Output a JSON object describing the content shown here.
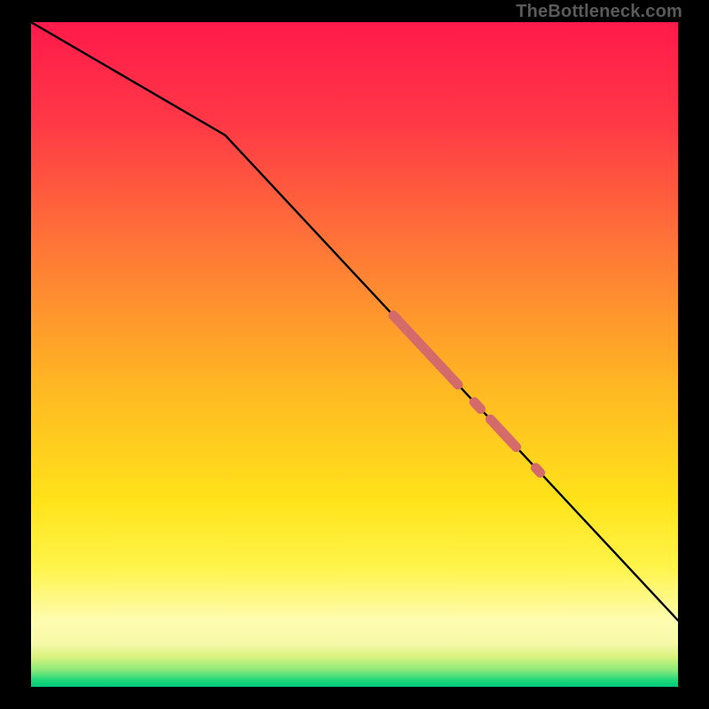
{
  "watermark": "TheBottleneck.com",
  "chart_data": {
    "type": "line",
    "title": "",
    "xlabel": "",
    "ylabel": "",
    "xlim": [
      0,
      100
    ],
    "ylim": [
      0,
      100
    ],
    "grid": false,
    "legend": false,
    "background_gradient_stops": [
      {
        "offset": 0.0,
        "color": "#ff1a4b"
      },
      {
        "offset": 0.15,
        "color": "#ff3846"
      },
      {
        "offset": 0.35,
        "color": "#ff7a36"
      },
      {
        "offset": 0.55,
        "color": "#ffb823"
      },
      {
        "offset": 0.72,
        "color": "#ffe31a"
      },
      {
        "offset": 0.82,
        "color": "#fff44a"
      },
      {
        "offset": 0.9,
        "color": "#fffcb0"
      },
      {
        "offset": 0.935,
        "color": "#f6f9a8"
      },
      {
        "offset": 0.955,
        "color": "#d9f27e"
      },
      {
        "offset": 0.975,
        "color": "#89e97a"
      },
      {
        "offset": 0.99,
        "color": "#1fd87a"
      },
      {
        "offset": 1.0,
        "color": "#00c877"
      }
    ],
    "series": [
      {
        "name": "curve",
        "stroke": "#000000",
        "stroke_width": 2.4,
        "points": [
          {
            "x": 0,
            "y": 100
          },
          {
            "x": 30,
            "y": 83
          },
          {
            "x": 100,
            "y": 10
          }
        ]
      }
    ],
    "highlight_segments": {
      "color": "#d46a6a",
      "cap_radius": 5.5,
      "stroke_width": 11,
      "segments": [
        {
          "x_start": 56,
          "x_end": 66
        },
        {
          "x_start": 68.5,
          "x_end": 69.5
        },
        {
          "x_start": 71,
          "x_end": 75
        },
        {
          "x_start": 78,
          "x_end": 78.7
        }
      ]
    }
  }
}
